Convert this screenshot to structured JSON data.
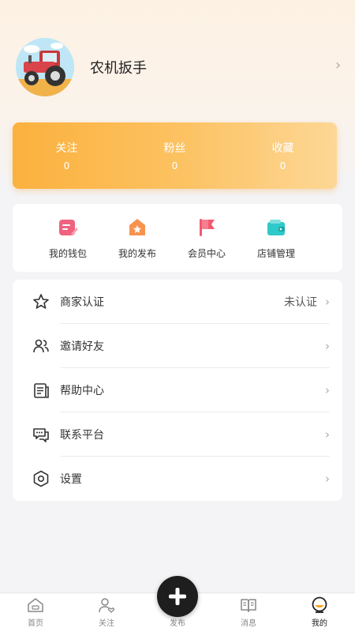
{
  "profile": {
    "username": "农机扳手",
    "avatar_icon": "tractor-avatar"
  },
  "stats": [
    {
      "label": "关注",
      "value": "0"
    },
    {
      "label": "粉丝",
      "value": "0"
    },
    {
      "label": "收藏",
      "value": "0"
    }
  ],
  "quick_actions": [
    {
      "label": "我的钱包",
      "icon": "wallet-icon",
      "color": "#f0627f"
    },
    {
      "label": "我的发布",
      "icon": "publish-icon",
      "color": "#f7934e"
    },
    {
      "label": "会员中心",
      "icon": "flag-icon",
      "color": "#f25a70"
    },
    {
      "label": "店铺管理",
      "icon": "store-icon",
      "color": "#2fc9c9"
    }
  ],
  "menu": [
    {
      "label": "商家认证",
      "value": "未认证",
      "icon": "star-icon"
    },
    {
      "label": "邀请好友",
      "value": "",
      "icon": "users-icon"
    },
    {
      "label": "帮助中心",
      "value": "",
      "icon": "help-doc-icon"
    },
    {
      "label": "联系平台",
      "value": "",
      "icon": "chat-icon"
    },
    {
      "label": "设置",
      "value": "",
      "icon": "settings-icon"
    }
  ],
  "tabbar": [
    {
      "label": "首页",
      "icon": "home-icon"
    },
    {
      "label": "关注",
      "icon": "follow-icon"
    },
    {
      "label": "发布",
      "icon": "publish-plus-icon"
    },
    {
      "label": "消息",
      "icon": "message-icon"
    },
    {
      "label": "我的",
      "icon": "profile-icon",
      "active": true
    }
  ],
  "colors": {
    "accent": "#fbb13e",
    "background": "#f4f4f6"
  }
}
